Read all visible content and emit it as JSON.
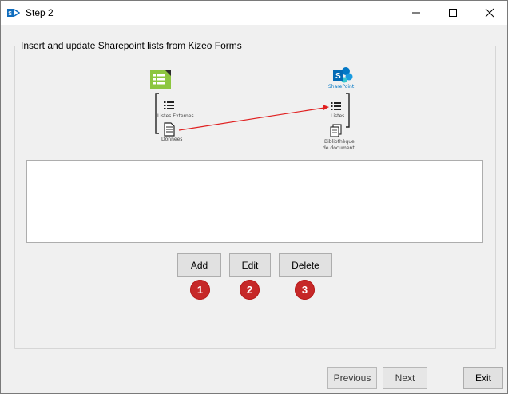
{
  "window": {
    "title": "Step 2",
    "minimize_icon": "minimize-icon",
    "maximize_icon": "maximize-icon",
    "close_icon": "close-icon"
  },
  "group": {
    "legend": "Insert and update Sharepoint lists from Kizeo Forms"
  },
  "diagram": {
    "kizeo_items": [
      "Listes Externes",
      "Données"
    ],
    "sharepoint_brand": "SharePoint",
    "sharepoint_items": [
      "Listes",
      "Bibliothèque",
      "de document"
    ],
    "arrow_color": "#e02020"
  },
  "actions": {
    "add_label": "Add",
    "edit_label": "Edit",
    "delete_label": "Delete",
    "badge_1": "1",
    "badge_2": "2",
    "badge_3": "3"
  },
  "footer": {
    "previous_label": "Previous",
    "next_label": "Next",
    "exit_label": "Exit"
  },
  "colors": {
    "badge": "#c62828",
    "kizeo_green": "#8cc63f",
    "sharepoint_blue": "#0378c6"
  }
}
